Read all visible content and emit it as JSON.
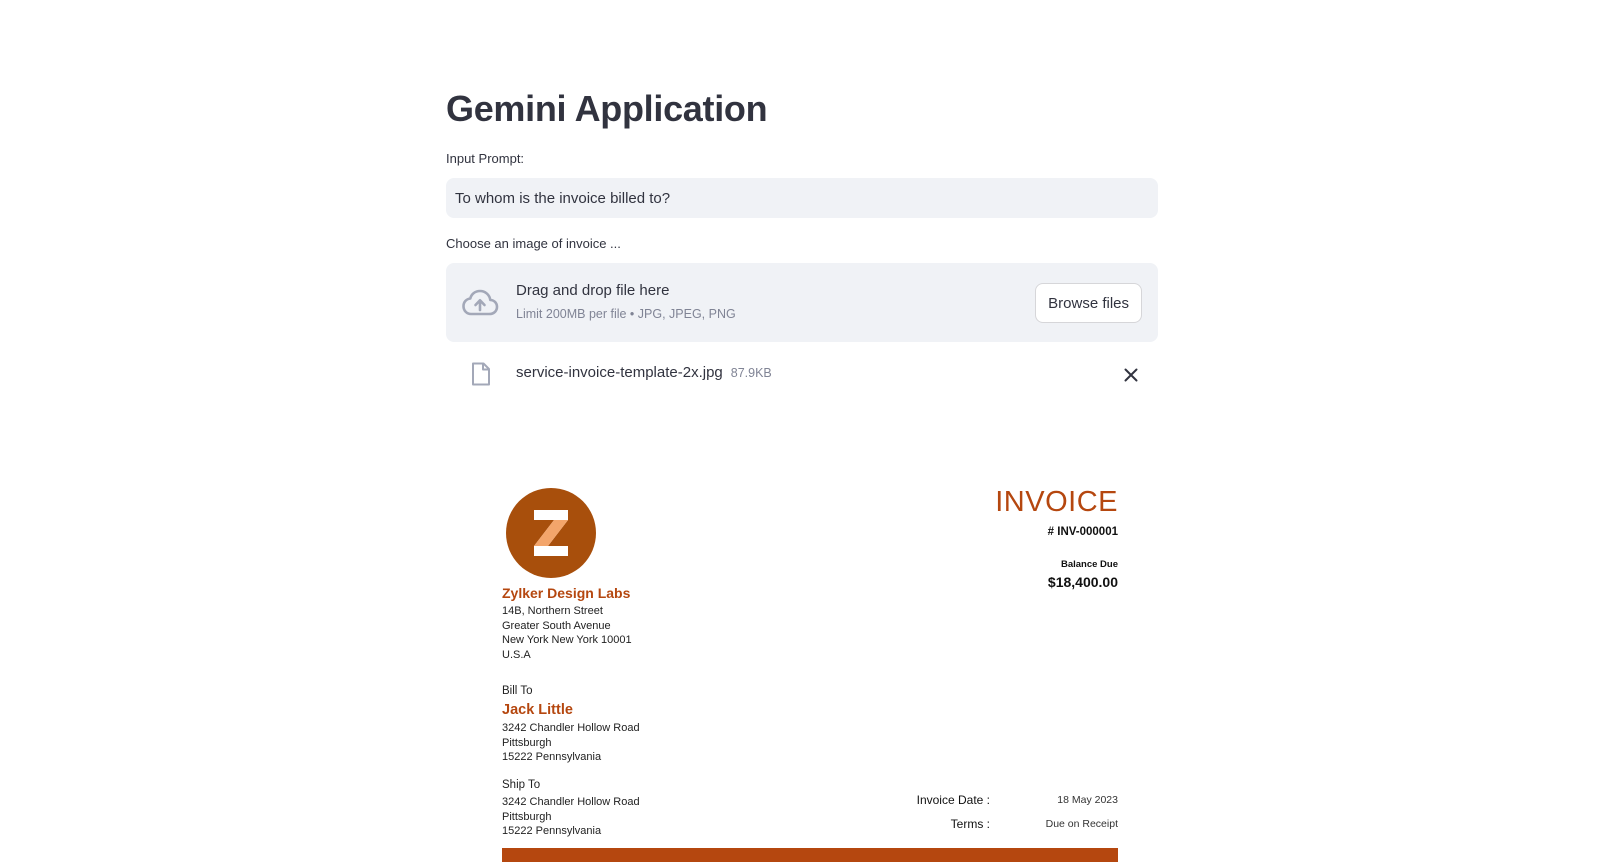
{
  "page": {
    "title": "Gemini Application"
  },
  "prompt": {
    "label": "Input Prompt:",
    "value": "To whom is the invoice billed to?"
  },
  "uploader": {
    "label": "Choose an image of invoice ...",
    "drop_text": "Drag and drop file here",
    "limit_text": "Limit 200MB per file • JPG, JPEG, PNG",
    "browse_label": "Browse files",
    "icon": "cloud-upload-icon"
  },
  "uploaded_file": {
    "name": "service-invoice-template-2x.jpg",
    "size": "87.9KB",
    "icon": "file-icon"
  },
  "invoice": {
    "brand_color": "#b5470f",
    "logo_letter": "Z",
    "title": "INVOICE",
    "number": "# INV-000001",
    "balance_label": "Balance Due",
    "balance_value": "$18,400.00",
    "company": {
      "name": "Zylker Design Labs",
      "address": [
        "14B, Northern Street",
        "Greater South Avenue",
        "New York New York 10001",
        "U.S.A"
      ]
    },
    "bill_to": {
      "label": "Bill To",
      "name": "Jack Little",
      "address": [
        "3242 Chandler Hollow Road",
        "Pittsburgh",
        "15222 Pennsylvania"
      ]
    },
    "ship_to": {
      "label": "Ship To",
      "address": [
        "3242 Chandler Hollow Road",
        "Pittsburgh",
        "15222 Pennsylvania"
      ]
    },
    "invoice_date_label": "Invoice Date :",
    "invoice_date_value": "18 May 2023",
    "terms_label": "Terms :",
    "terms_value": "Due on Receipt"
  }
}
